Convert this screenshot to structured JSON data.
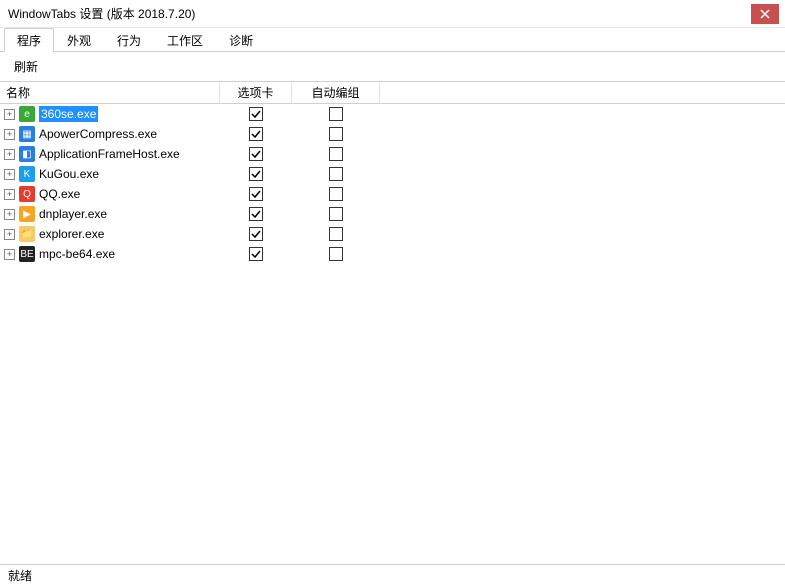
{
  "window": {
    "title": "WindowTabs 设置 (版本 2018.7.20)"
  },
  "tabs": {
    "items": [
      {
        "label": "程序"
      },
      {
        "label": "外观"
      },
      {
        "label": "行为"
      },
      {
        "label": "工作区"
      },
      {
        "label": "诊断"
      }
    ],
    "active_index": 0
  },
  "toolbar": {
    "refresh_label": "刷新"
  },
  "columns": {
    "name": "名称",
    "tab": "选项卡",
    "auto": "自动编组"
  },
  "rows": [
    {
      "name": "360se.exe",
      "icon_color": "#39a839",
      "icon_glyph": "e",
      "tab_checked": true,
      "auto_checked": false,
      "selected": true
    },
    {
      "name": "ApowerCompress.exe",
      "icon_color": "#2a7de1",
      "icon_glyph": "▦",
      "tab_checked": true,
      "auto_checked": false,
      "selected": false
    },
    {
      "name": "ApplicationFrameHost.exe",
      "icon_color": "#2a7de1",
      "icon_glyph": "◧",
      "tab_checked": true,
      "auto_checked": false,
      "selected": false
    },
    {
      "name": "KuGou.exe",
      "icon_color": "#1aa0e8",
      "icon_glyph": "K",
      "tab_checked": true,
      "auto_checked": false,
      "selected": false
    },
    {
      "name": "QQ.exe",
      "icon_color": "#e43d30",
      "icon_glyph": "Q",
      "tab_checked": true,
      "auto_checked": false,
      "selected": false
    },
    {
      "name": "dnplayer.exe",
      "icon_color": "#f5a623",
      "icon_glyph": "▶",
      "tab_checked": true,
      "auto_checked": false,
      "selected": false
    },
    {
      "name": "explorer.exe",
      "icon_color": "#f7c96b",
      "icon_glyph": "📁",
      "tab_checked": true,
      "auto_checked": false,
      "selected": false
    },
    {
      "name": "mpc-be64.exe",
      "icon_color": "#222222",
      "icon_glyph": "BE",
      "tab_checked": true,
      "auto_checked": false,
      "selected": false
    }
  ],
  "statusbar": {
    "text": "就绪"
  }
}
